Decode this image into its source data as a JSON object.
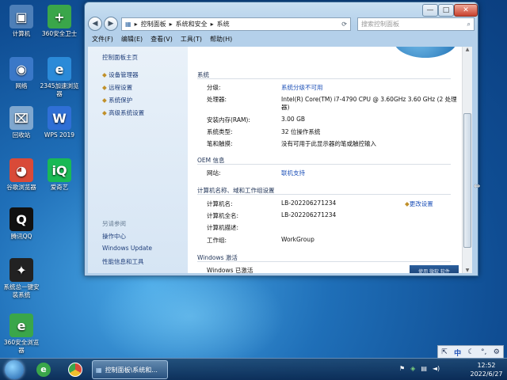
{
  "desktop": {
    "icons": [
      {
        "label": "计算机",
        "glyph": "▣",
        "color": "#4d7fb8"
      },
      {
        "label": "360安全卫士",
        "glyph": "+",
        "color": "#3aa64a"
      },
      {
        "label": "网络",
        "glyph": "◉",
        "color": "#3a78c8"
      },
      {
        "label": "2345加速浏览器",
        "glyph": "e",
        "color": "#2b8ad8"
      },
      {
        "label": "回收站",
        "glyph": "⌧",
        "color": "#7fa7cf"
      },
      {
        "label": "WPS 2019",
        "glyph": "W",
        "color": "#2f6fd6"
      },
      {
        "label": "谷歌浏览器",
        "glyph": "◕",
        "color": "#d94a38"
      },
      {
        "label": "爱奇艺",
        "glyph": "iQ",
        "color": "#19b955"
      },
      {
        "label": "腾讯QQ",
        "glyph": "Q",
        "color": "#111111"
      },
      {
        "label": "系统总一键安装系统",
        "glyph": "✦",
        "color": "#222"
      },
      {
        "label": "360安全浏览器",
        "glyph": "e",
        "color": "#3aa64a"
      }
    ]
  },
  "window": {
    "title": "",
    "controls": {
      "min": "—",
      "max": "□",
      "close": "✕"
    },
    "breadcrumb": [
      "控制面板",
      "系统和安全",
      "系统"
    ],
    "search_placeholder": "搜索控制面板",
    "menu": [
      "文件(F)",
      "编辑(E)",
      "查看(V)",
      "工具(T)",
      "帮助(H)"
    ],
    "sidebar": {
      "home": "控制面板主页",
      "links": [
        "设备管理器",
        "远程设置",
        "系统保护",
        "高级系统设置"
      ],
      "see_also": "另请参阅",
      "see_links": [
        "操作中心",
        "Windows Update",
        "性能信息和工具"
      ]
    },
    "main": {
      "system_title": "系统",
      "rating_label": "分级:",
      "rating_value": "系统分级不可用",
      "cpu_label": "处理器:",
      "cpu_value": "Intel(R) Core(TM) i7-4790 CPU @ 3.60GHz   3.60 GHz  (2 处理",
      "cpu_value2": "器)",
      "ram_label": "安装内存(RAM):",
      "ram_value": "3.00 GB",
      "type_label": "系统类型:",
      "type_value": "32 位操作系统",
      "pen_label": "笔和触摸:",
      "pen_value": "没有可用于此显示器的笔或触控输入",
      "oem_title": "OEM 信息",
      "web_label": "网站:",
      "web_value": "联机支持",
      "net_title": "计算机名称、域和工作组设置",
      "cname_label": "计算机名:",
      "cname_value": "LB-202206271234",
      "change": "更改设置",
      "fname_label": "计算机全名:",
      "fname_value": "LB-202206271234",
      "desc_label": "计算机描述:",
      "wg_label": "工作组:",
      "wg_value": "WorkGroup",
      "act_title": "Windows 激活",
      "act_value": "Windows 已激活",
      "genuine": "使用 微软 软件"
    }
  },
  "taskbar": {
    "task_label": "控制面板\\系统和...",
    "time": "12:52",
    "date": "2022/6/27"
  },
  "tray": {
    "items": [
      "⇱",
      "中",
      "☾",
      "°,",
      "⚙"
    ]
  }
}
